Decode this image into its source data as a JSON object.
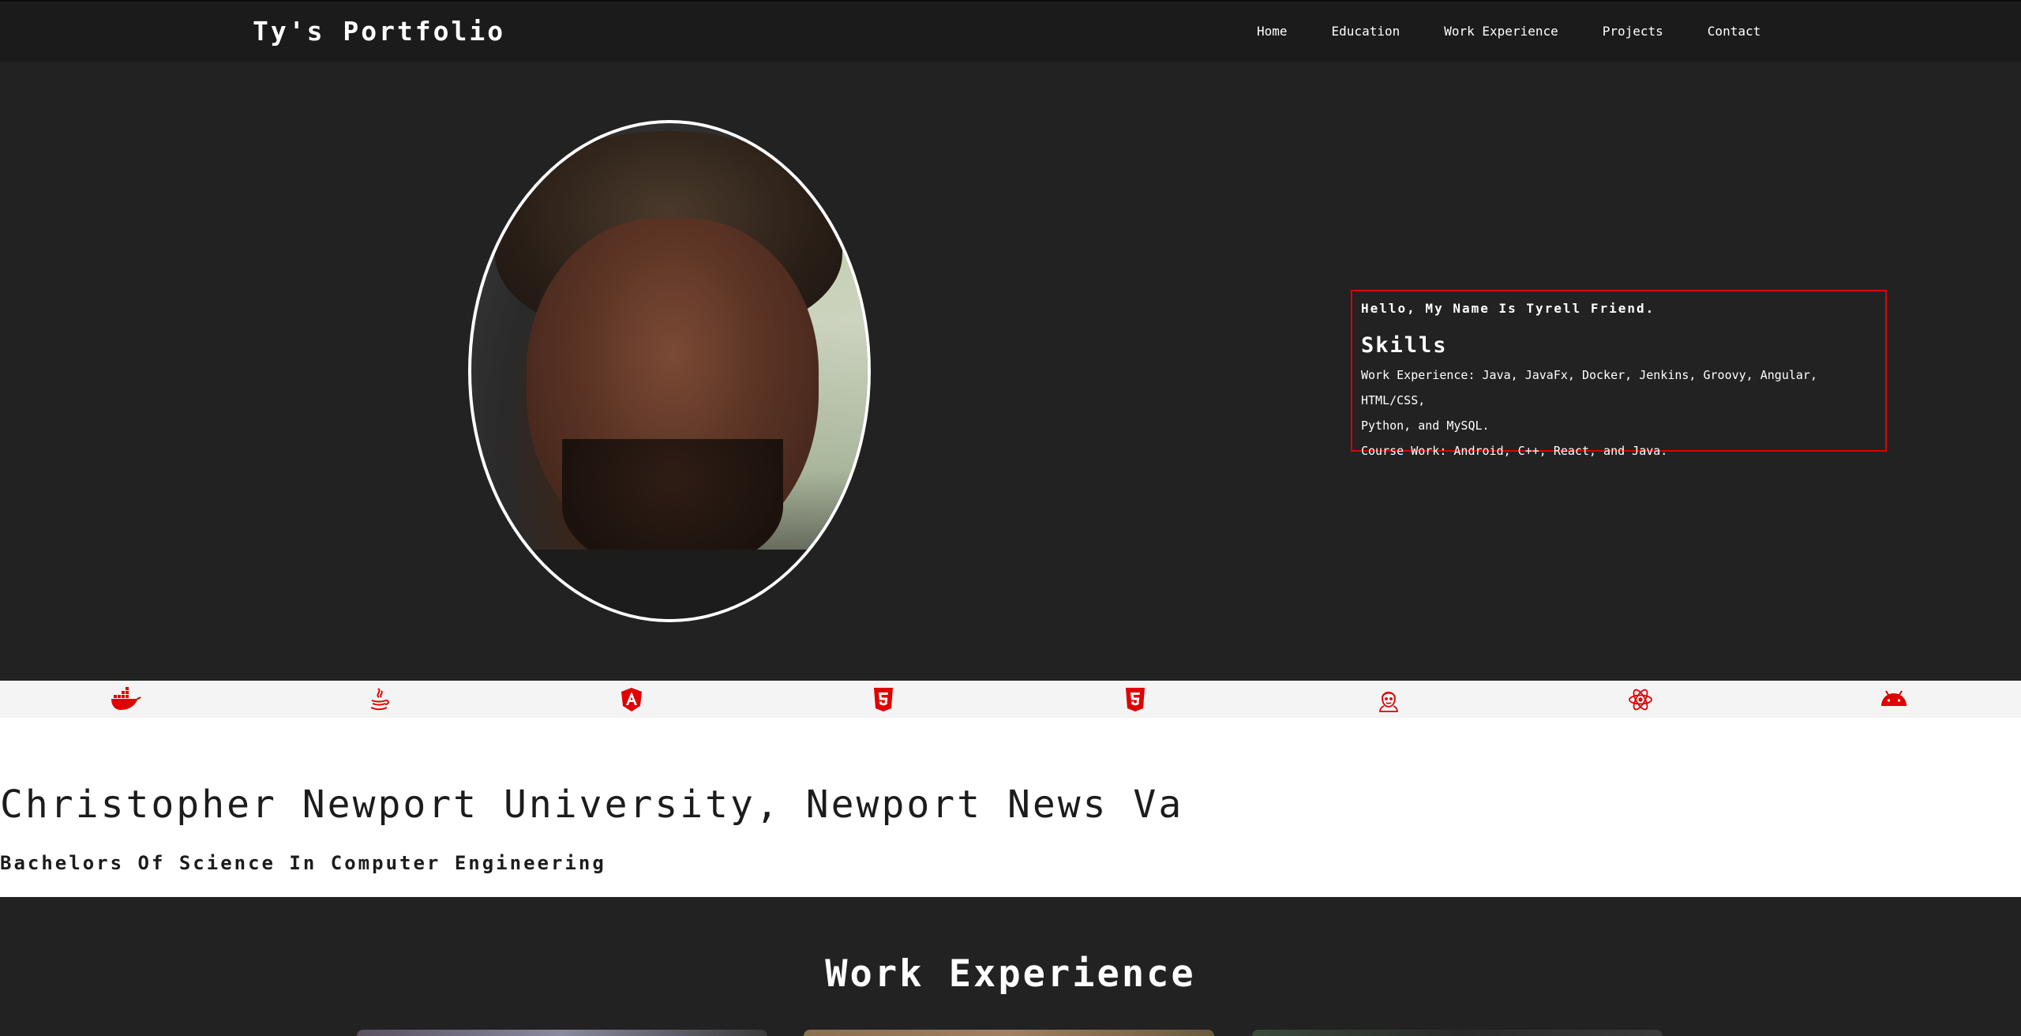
{
  "brand": "Ty's Portfolio",
  "nav": {
    "home": "Home",
    "education": "Education",
    "work": "Work Experience",
    "projects": "Projects",
    "contact": "Contact"
  },
  "intro": {
    "greeting": "Hello, My Name Is Tyrell Friend.",
    "skills_title": "Skills",
    "work_experience": "Work Experience: Java, JavaFx, Docker, Jenkins, Groovy, Angular, HTML/CSS,",
    "work_experience_cont": "Python, and MySQL.",
    "course_work": "Course Work: Android, C++, React, and Java."
  },
  "icons": [
    "docker-icon",
    "java-icon",
    "angular-icon",
    "html5-icon",
    "css3-icon",
    "jenkins-icon",
    "react-icon",
    "android-icon"
  ],
  "education": {
    "school": "Christopher Newport University, Newport News Va",
    "degree": "Bachelors Of Science In Computer Engineering"
  },
  "work": {
    "title": "Work Experience"
  },
  "colors": {
    "accent": "#e00000",
    "dark_bg": "#222222",
    "nav_bg": "#1b1b1b",
    "strip_bg": "#f4f4f4"
  }
}
